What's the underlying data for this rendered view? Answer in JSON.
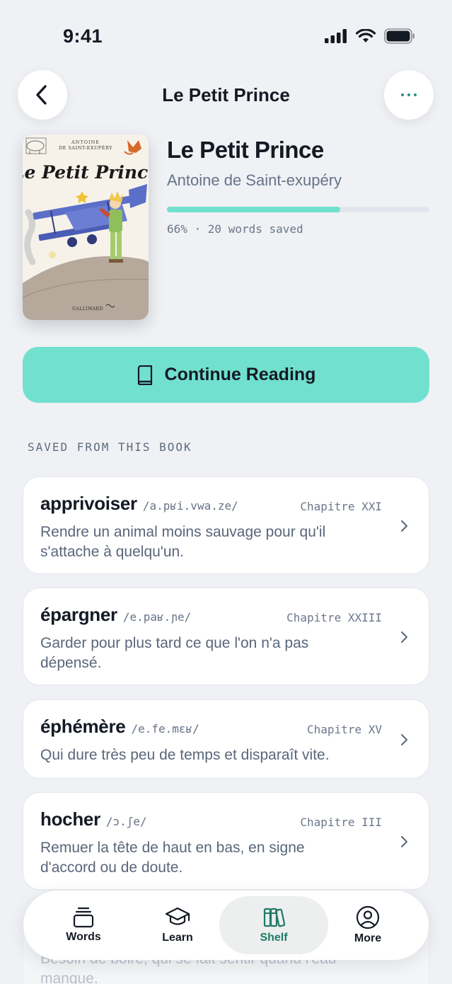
{
  "status_bar": {
    "time": "9:41"
  },
  "header": {
    "title": "Le Petit Prince"
  },
  "book": {
    "title": "Le Petit Prince",
    "author": "Antoine de Saint-exupéry",
    "progress": 0.66,
    "progress_text": "66% · 20 words saved",
    "cover": {
      "author_line1": "ANTOINE",
      "author_line2": "DE SAINT-EXUPÉRY",
      "title": "Le Petit Prince",
      "publisher": "GALLIMARD"
    }
  },
  "continue_button": {
    "label": "Continue Reading",
    "icon": "book-icon"
  },
  "section_header": "SAVED FROM THIS BOOK",
  "words": [
    {
      "term": "apprivoiser",
      "ipa": "/a.pʁi.vwa.ze/",
      "chapter": "Chapitre XXI",
      "definition": "Rendre un animal moins sauvage pour qu'il s'attache à quelqu'un."
    },
    {
      "term": "épargner",
      "ipa": "/e.paʁ.ɲe/",
      "chapter": "Chapitre XXIII",
      "definition": "Garder pour plus tard ce que l'on n'a pas dépensé."
    },
    {
      "term": "éphémère",
      "ipa": "/e.fe.mɛʁ/",
      "chapter": "Chapitre XV",
      "definition": "Qui dure très peu de temps et disparaît vite."
    },
    {
      "term": "hocher",
      "ipa": "/ɔ.ʃe/",
      "chapter": "Chapitre III",
      "definition": "Remuer la tête de haut en bas, en signe d'accord ou de doute."
    }
  ],
  "peek_word": {
    "definition": "Besoin de boire, qui se fait sentir quand l'eau manque."
  },
  "tabs": [
    {
      "label": "Words",
      "icon": "cards-stack-icon",
      "active": false
    },
    {
      "label": "Learn",
      "icon": "graduation-cap-icon",
      "active": false
    },
    {
      "label": "Shelf",
      "icon": "books-icon",
      "active": true
    },
    {
      "label": "More",
      "icon": "user-circle-icon",
      "active": false
    }
  ],
  "colors": {
    "accent": "#72e0cf",
    "active_tab_text": "#1f7a66",
    "background": "#eff1f4"
  }
}
